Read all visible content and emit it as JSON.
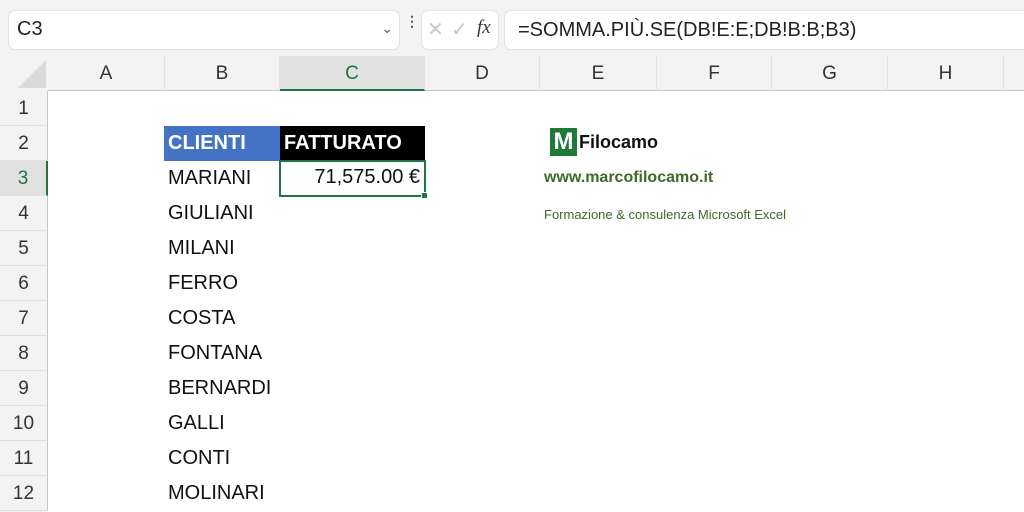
{
  "formula_bar": {
    "name_box": "C3",
    "name_box_chevron": "⌄",
    "options_icon": "⋮",
    "cancel_icon": "✕",
    "enter_icon": "✓",
    "fx_label": "fx",
    "formula": "=SOMMA.PIÙ.SE(DB!E:E;DB!B:B;B3)"
  },
  "columns": [
    "A",
    "B",
    "C",
    "D",
    "E",
    "F",
    "G",
    "H"
  ],
  "selected_column": "C",
  "rows": [
    "1",
    "2",
    "3",
    "4",
    "5",
    "6",
    "7",
    "8",
    "9",
    "10",
    "11",
    "12"
  ],
  "selected_row": "3",
  "table": {
    "header_clienti": "CLIENTI",
    "header_fatturato": "FATTURATO",
    "header_clienti_color": "#4472c4",
    "header_fatturato_color": "#000000",
    "clienti": [
      "MARIANI",
      "GIULIANI",
      "MILANI",
      "FERRO",
      "COSTA",
      "FONTANA",
      "BERNARDI",
      "GALLI",
      "CONTI",
      "MOLINARI"
    ],
    "fatturato_c3": "71,575.00 €"
  },
  "branding": {
    "logo_letter": "M",
    "logo_text": "Filocamo",
    "logo_color": "#1e7a3a",
    "website": "www.marcofilocamo.it",
    "tagline": "Formazione & consulenza Microsoft Excel"
  },
  "accent_color": "#217346"
}
